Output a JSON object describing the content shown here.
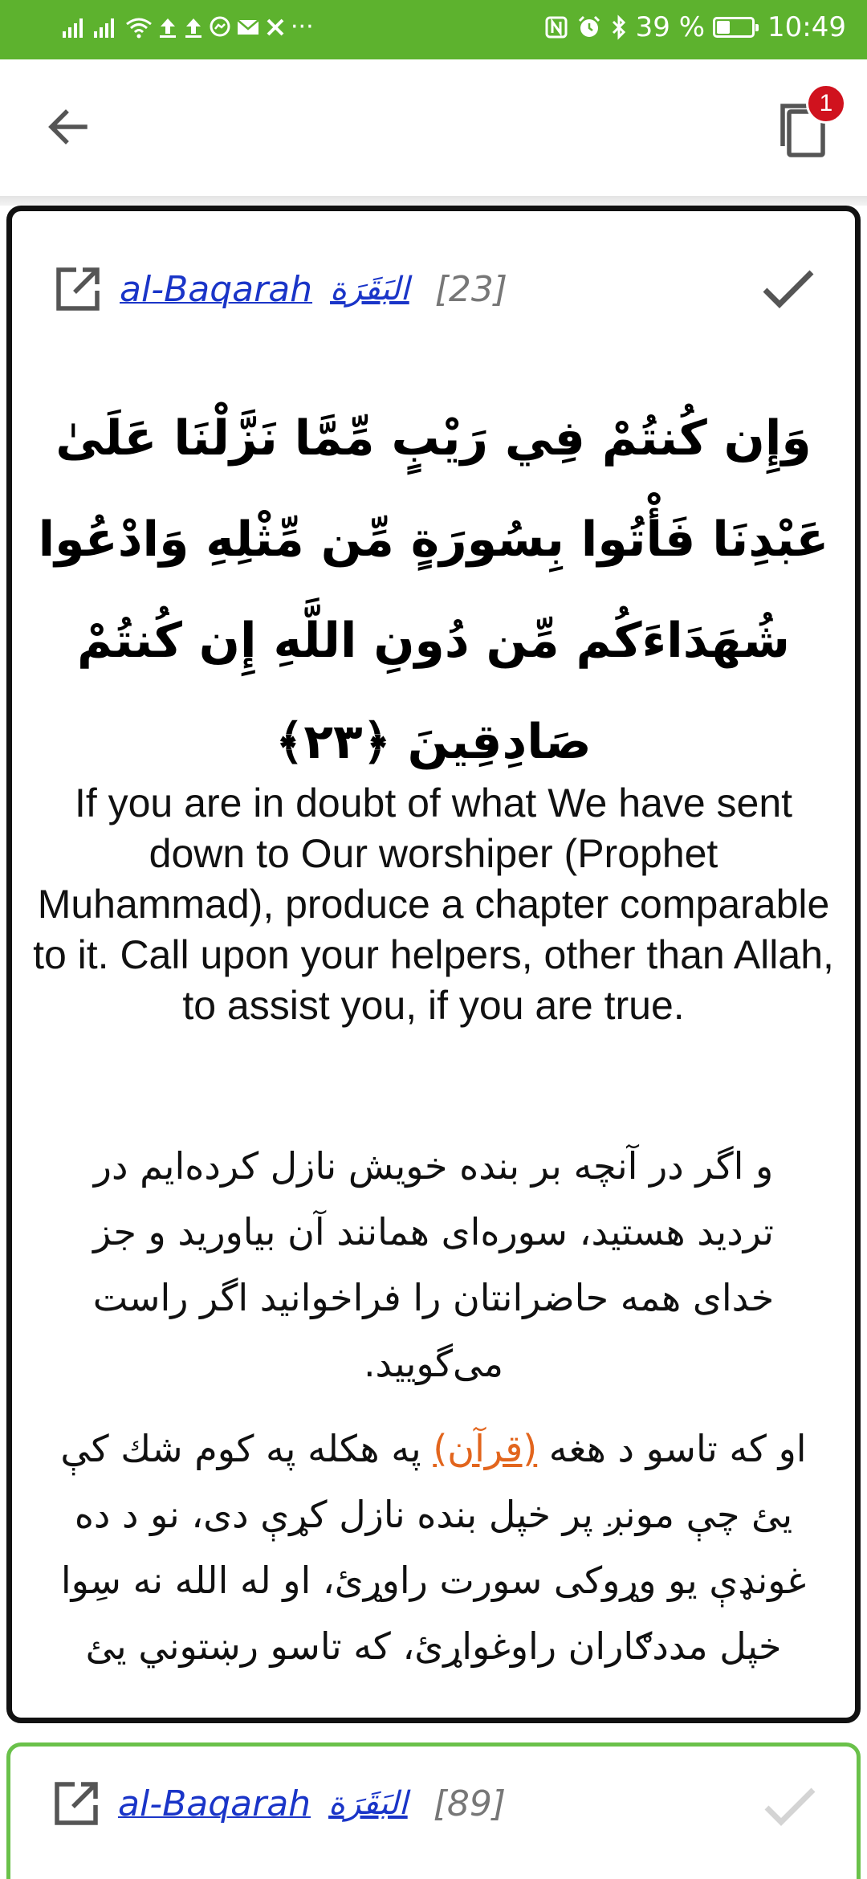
{
  "status_bar": {
    "icons_left": [
      "signal-icon",
      "signal-icon",
      "wifi-icon",
      "upload-icon",
      "upload-icon",
      "messenger-icon",
      "mail-icon",
      "x-icon",
      "more-icon"
    ],
    "more_text": "···",
    "icons_right": [
      "nfc-icon",
      "alarm-icon",
      "bluetooth-icon",
      "battery-icon"
    ],
    "battery_text": "39 %",
    "time": "10:49",
    "color": "#5db22e"
  },
  "app_bar": {
    "back_icon": "arrow-left-icon",
    "copy_icon": "copy-icon",
    "copy_badge": "1",
    "badge_color": "#d0121e"
  },
  "verse_card": {
    "surah_link": "al-Baqarah",
    "surah_arabic": "البَقَرَة",
    "ayah_number": "[23]",
    "arabic_text": "وَإِن كُنتُمْ فِي رَيْبٍ مِّمَّا نَزَّلْنَا عَلَىٰ عَبْدِنَا فَأْتُوا بِسُورَةٍ مِّن مِّثْلِهِ وَادْعُوا شُهَدَاءَكُم مِّن دُونِ اللَّهِ إِن كُنتُمْ صَادِقِينَ ﴿٢٣﴾",
    "translation_en": "If you are in doubt of what We have sent down to Our worshiper (Prophet Muhammad), produce a chapter comparable to it. Call upon your helpers, other than Allah, to assist you, if you are true.",
    "translation_fa": "و اگر در آنچه بر بنده خویش نازل کرده‌ایم در تردید هستید، سوره‌ای همانند آن بیاورید و جز خدای همه حاضرانتان را فراخوانید اگر راست می‌گویید.",
    "translation_ps_before": "او که تاسو د هغه ",
    "translation_ps_link": "(قرآن)",
    "translation_ps_after": " په هکله په کوم شك کې یئ چې مونږ پر خپل بنده نازل کړې دی، نو د ده غونډې یو وړوکی سورت راوړئ، او له الله نه سِوا خپل مددګاران راوغواړئ، که تاسو رښتوني یئ",
    "border_color": "#111111",
    "link_color": "#1a35c8",
    "quran_link_color": "#e2651d"
  },
  "next_card": {
    "surah_link": "al-Baqarah",
    "surah_arabic": "البَقَرَة",
    "ayah_number": "[89]",
    "border_color": "#6ac14a"
  }
}
